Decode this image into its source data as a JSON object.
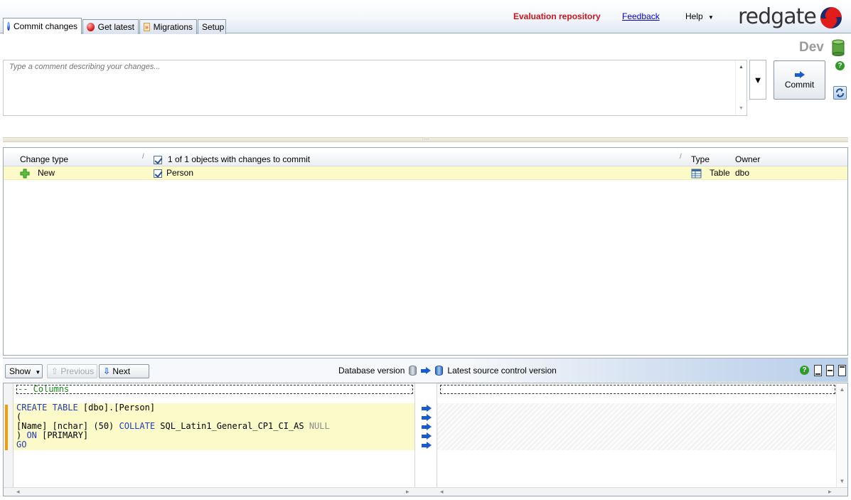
{
  "tabs": [
    {
      "label": "Commit changes",
      "icon": "blue-ball-icon",
      "active": true
    },
    {
      "label": "Get latest",
      "icon": "red-ball-icon",
      "active": false
    },
    {
      "label": "Migrations",
      "icon": "double-chevron-icon",
      "active": false
    },
    {
      "label": "Setup",
      "icon": "",
      "active": false
    }
  ],
  "header": {
    "evaluation_label": "Evaluation repository",
    "feedback_link": "Feedback",
    "help_menu": "Help",
    "logo_text": "redgate"
  },
  "commit_panel": {
    "database_name": "Dev",
    "comment_placeholder": "Type a comment describing your changes...",
    "commit_button": "Commit"
  },
  "grid": {
    "columns": {
      "change_type": "Change type",
      "summary": "1 of 1 objects with changes to commit",
      "type": "Type",
      "owner": "Owner"
    },
    "rows": [
      {
        "change_type": "New",
        "checked": true,
        "name": "Person",
        "type": "Table",
        "owner": "dbo"
      }
    ]
  },
  "diff_toolbar": {
    "show_button": "Show",
    "previous_button": "Previous",
    "next_button": "Next",
    "database_version": "Database version",
    "source_version": "Latest source control version"
  },
  "diff": {
    "left_header_comment": "-- Columns",
    "lines": [
      "CREATE TABLE [dbo].[Person]",
      "(",
      "[Name] [nchar] (50) COLLATE SQL_Latin1_General_CP1_CI_AS NULL",
      ") ON [PRIMARY]",
      "GO"
    ]
  },
  "colors": {
    "evaluation_red": "#d0121b",
    "highlight_yellow": "#fdfac9",
    "change_marker": "#f0a000",
    "sql_keyword": "#1f3cc4",
    "sql_comment": "#178a17"
  }
}
